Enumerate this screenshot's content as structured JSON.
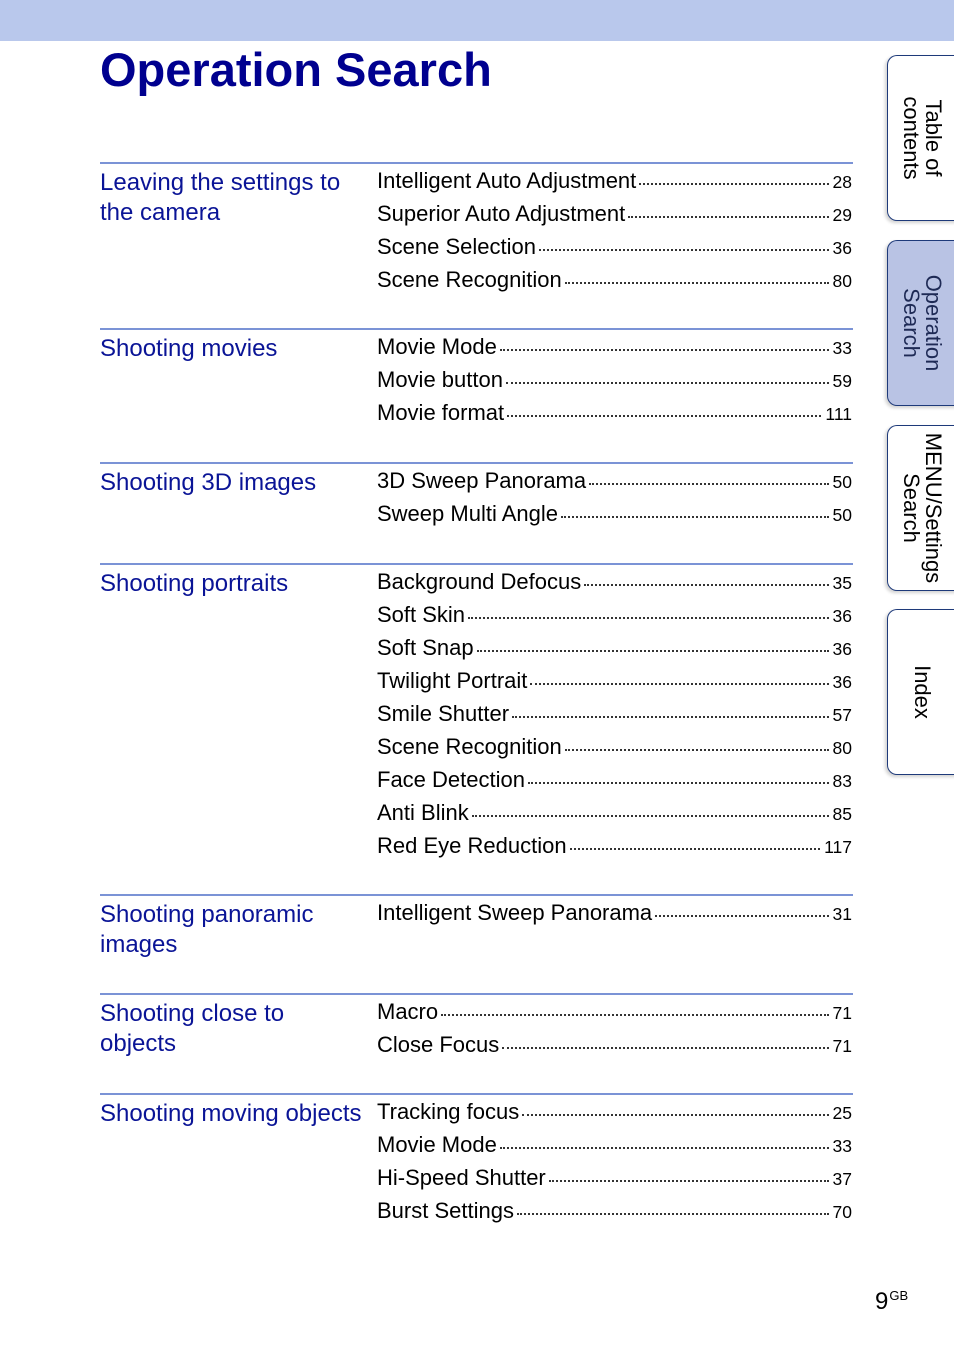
{
  "header": {
    "title": "Operation Search"
  },
  "sections": [
    {
      "title": "Leaving the settings to the camera",
      "entries": [
        {
          "label": "Intelligent Auto Adjustment",
          "page": "28"
        },
        {
          "label": "Superior Auto Adjustment",
          "page": "29"
        },
        {
          "label": "Scene Selection",
          "page": "36"
        },
        {
          "label": "Scene Recognition",
          "page": "80"
        }
      ]
    },
    {
      "title": "Shooting movies",
      "entries": [
        {
          "label": "Movie Mode",
          "page": "33"
        },
        {
          "label": "Movie button",
          "page": "59"
        },
        {
          "label": "Movie format",
          "page": "111"
        }
      ]
    },
    {
      "title": "Shooting 3D images",
      "entries": [
        {
          "label": "3D Sweep Panorama",
          "page": "50"
        },
        {
          "label": "Sweep Multi Angle",
          "page": "50"
        }
      ]
    },
    {
      "title": "Shooting portraits",
      "entries": [
        {
          "label": "Background Defocus",
          "page": "35"
        },
        {
          "label": "Soft Skin",
          "page": "36"
        },
        {
          "label": "Soft Snap",
          "page": "36"
        },
        {
          "label": "Twilight Portrait",
          "page": "36"
        },
        {
          "label": "Smile Shutter",
          "page": "57"
        },
        {
          "label": "Scene Recognition",
          "page": "80"
        },
        {
          "label": "Face Detection",
          "page": "83"
        },
        {
          "label": "Anti Blink",
          "page": "85"
        },
        {
          "label": "Red Eye Reduction",
          "page": "117"
        }
      ]
    },
    {
      "title": "Shooting panoramic images",
      "entries": [
        {
          "label": "Intelligent Sweep Panorama",
          "page": "31"
        }
      ]
    },
    {
      "title": "Shooting close to objects",
      "entries": [
        {
          "label": "Macro",
          "page": "71"
        },
        {
          "label": "Close Focus",
          "page": "71"
        }
      ]
    },
    {
      "title": "Shooting moving objects",
      "entries": [
        {
          "label": "Tracking focus",
          "page": "25"
        },
        {
          "label": "Movie Mode",
          "page": "33"
        },
        {
          "label": "Hi-Speed Shutter",
          "page": "37"
        },
        {
          "label": "Burst Settings",
          "page": "70"
        }
      ]
    }
  ],
  "side_tabs": [
    {
      "label": "Table of\ncontents",
      "active": false
    },
    {
      "label": "Operation\nSearch",
      "active": true
    },
    {
      "label": "MENU/Settings\nSearch",
      "active": false
    },
    {
      "label": "Index",
      "active": false
    }
  ],
  "footer": {
    "page_number": "9",
    "page_suffix": "GB"
  },
  "colors": {
    "title": "#00008f",
    "section_title": "#0a1496",
    "rule": "#7b93d6",
    "top_band": "#b9c8ec",
    "active_tab": "#b9c3e4"
  }
}
